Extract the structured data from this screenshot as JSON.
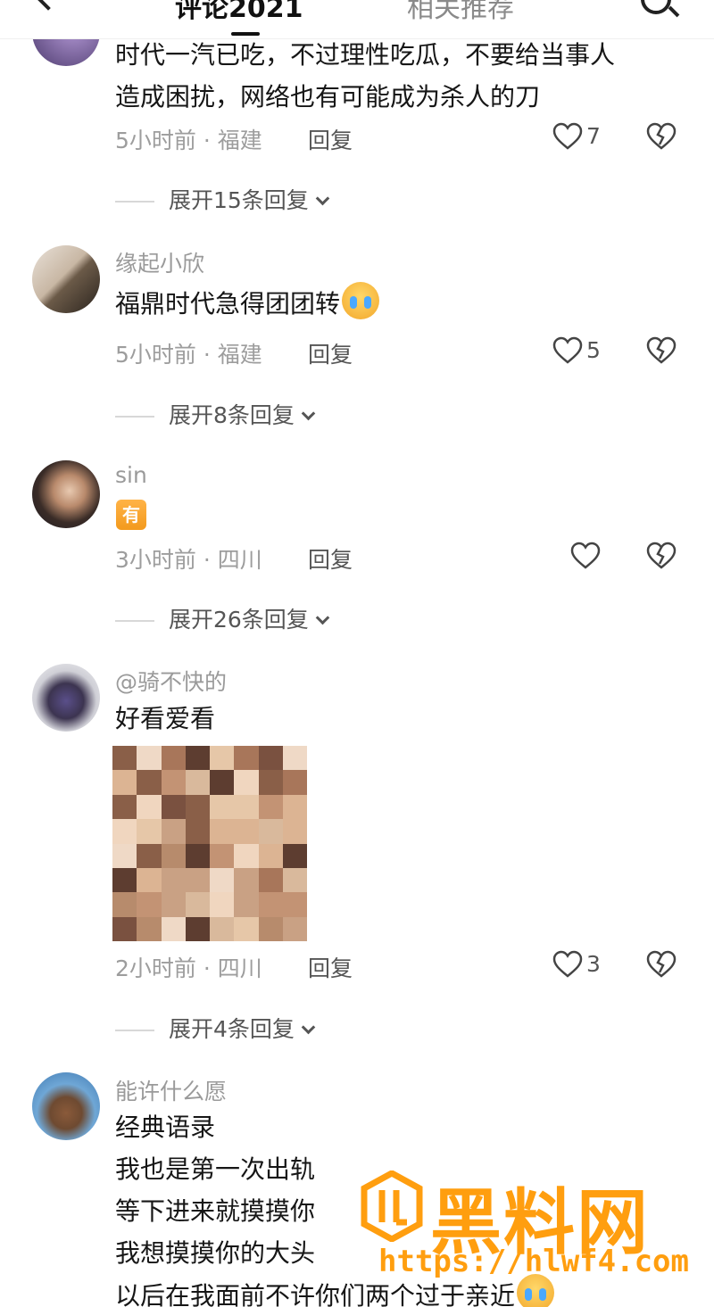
{
  "header": {
    "tab_comments": "评论2021",
    "tab_related": "相关推荐"
  },
  "comments": [
    {
      "username": "",
      "lines": [
        "时代一汽已吃，不过理性吃瓜，不要给当事人",
        "造成困扰，网络也有可能成为杀人的刀"
      ],
      "time": "5小时前",
      "location": "福建",
      "reply_label": "回复",
      "likes": "7",
      "expand_label": "展开15条回复"
    },
    {
      "username": "缘起小欣",
      "lines": [
        "福鼎时代急得团团转"
      ],
      "time": "5小时前",
      "location": "福建",
      "reply_label": "回复",
      "likes": "5",
      "expand_label": "展开8条回复"
    },
    {
      "username": "sin",
      "badge": "有",
      "time": "3小时前",
      "location": "四川",
      "reply_label": "回复",
      "likes": "",
      "expand_label": "展开26条回复"
    },
    {
      "username": "@骑不快的",
      "lines": [
        "好看爱看"
      ],
      "time": "2小时前",
      "location": "四川",
      "reply_label": "回复",
      "likes": "3",
      "expand_label": "展开4条回复"
    },
    {
      "username": "能许什么愿",
      "lines": [
        "经典语录",
        "我也是第一次出轨",
        "等下进来就摸摸你",
        "我想摸摸你的大头",
        "以后在我面前不许你们两个过于亲近"
      ]
    }
  ],
  "meta_separator": " · ",
  "watermark": {
    "text": "黑料网",
    "url": "https://hlwf4.com"
  },
  "colors": {
    "watermark": "#ff9e0f",
    "badge": "#f39a1d",
    "meta": "#9d9d9d"
  }
}
